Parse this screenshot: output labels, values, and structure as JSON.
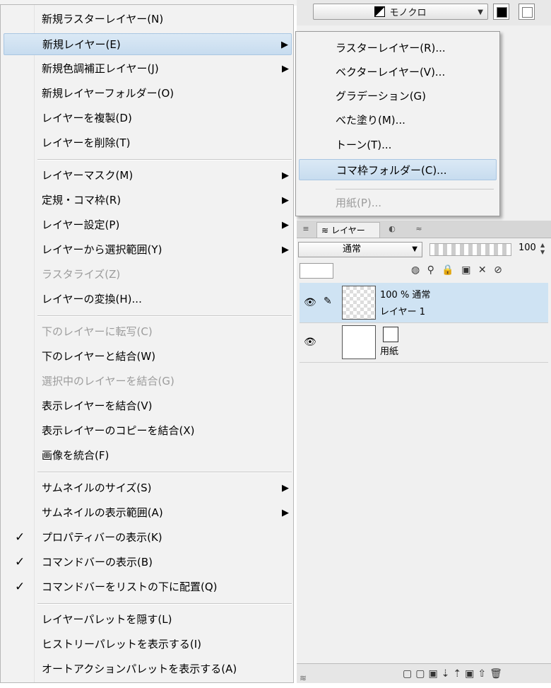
{
  "color_mode": {
    "label": "モノクロ"
  },
  "layer_panel": {
    "tab_label": "レイヤー",
    "blend_mode": "通常",
    "opacity": "100",
    "layers": [
      {
        "line1": "100 % 通常",
        "line2": "レイヤー 1",
        "selected": true
      },
      {
        "line1": "",
        "line2": "用紙",
        "selected": false
      }
    ]
  },
  "main_menu": {
    "items": [
      {
        "label": "新規ラスターレイヤー(N)"
      },
      {
        "label": "新規レイヤー(E)",
        "submenu": true
      },
      {
        "label": "新規色調補正レイヤー(J)",
        "submenu": true
      },
      {
        "label": "新規レイヤーフォルダー(O)"
      },
      {
        "label": "レイヤーを複製(D)"
      },
      {
        "label": "レイヤーを削除(T)"
      },
      {
        "label": "レイヤーマスク(M)",
        "submenu": true
      },
      {
        "label": "定規・コマ枠(R)",
        "submenu": true
      },
      {
        "label": "レイヤー設定(P)",
        "submenu": true
      },
      {
        "label": "レイヤーから選択範囲(Y)",
        "submenu": true
      },
      {
        "label": "ラスタライズ(Z)",
        "disabled": true
      },
      {
        "label": "レイヤーの変換(H)..."
      },
      {
        "label": "下のレイヤーに転写(C)",
        "disabled": true
      },
      {
        "label": "下のレイヤーと結合(W)"
      },
      {
        "label": "選択中のレイヤーを結合(G)",
        "disabled": true
      },
      {
        "label": "表示レイヤーを結合(V)"
      },
      {
        "label": "表示レイヤーのコピーを結合(X)"
      },
      {
        "label": "画像を統合(F)"
      },
      {
        "label": "サムネイルのサイズ(S)",
        "submenu": true
      },
      {
        "label": "サムネイルの表示範囲(A)",
        "submenu": true
      },
      {
        "label": "プロパティバーの表示(K)",
        "checked": true
      },
      {
        "label": "コマンドバーの表示(B)",
        "checked": true
      },
      {
        "label": "コマンドバーをリストの下に配置(Q)",
        "checked": true
      },
      {
        "label": "レイヤーパレットを隠す(L)"
      },
      {
        "label": "ヒストリーパレットを表示する(I)"
      },
      {
        "label": "オートアクションパレットを表示する(A)"
      }
    ]
  },
  "sub_menu": {
    "items": [
      {
        "label": "ラスターレイヤー(R)..."
      },
      {
        "label": "ベクターレイヤー(V)..."
      },
      {
        "label": "グラデーション(G)"
      },
      {
        "label": "べた塗り(M)..."
      },
      {
        "label": "トーン(T)..."
      },
      {
        "label": "コマ枠フォルダー(C)..."
      },
      {
        "label": "用紙(P)...",
        "disabled": true
      }
    ]
  },
  "colors": {
    "highlight": "#c7dcef",
    "menu_bg": "#f2f2f2",
    "disabled_text": "#9c9c9c"
  }
}
